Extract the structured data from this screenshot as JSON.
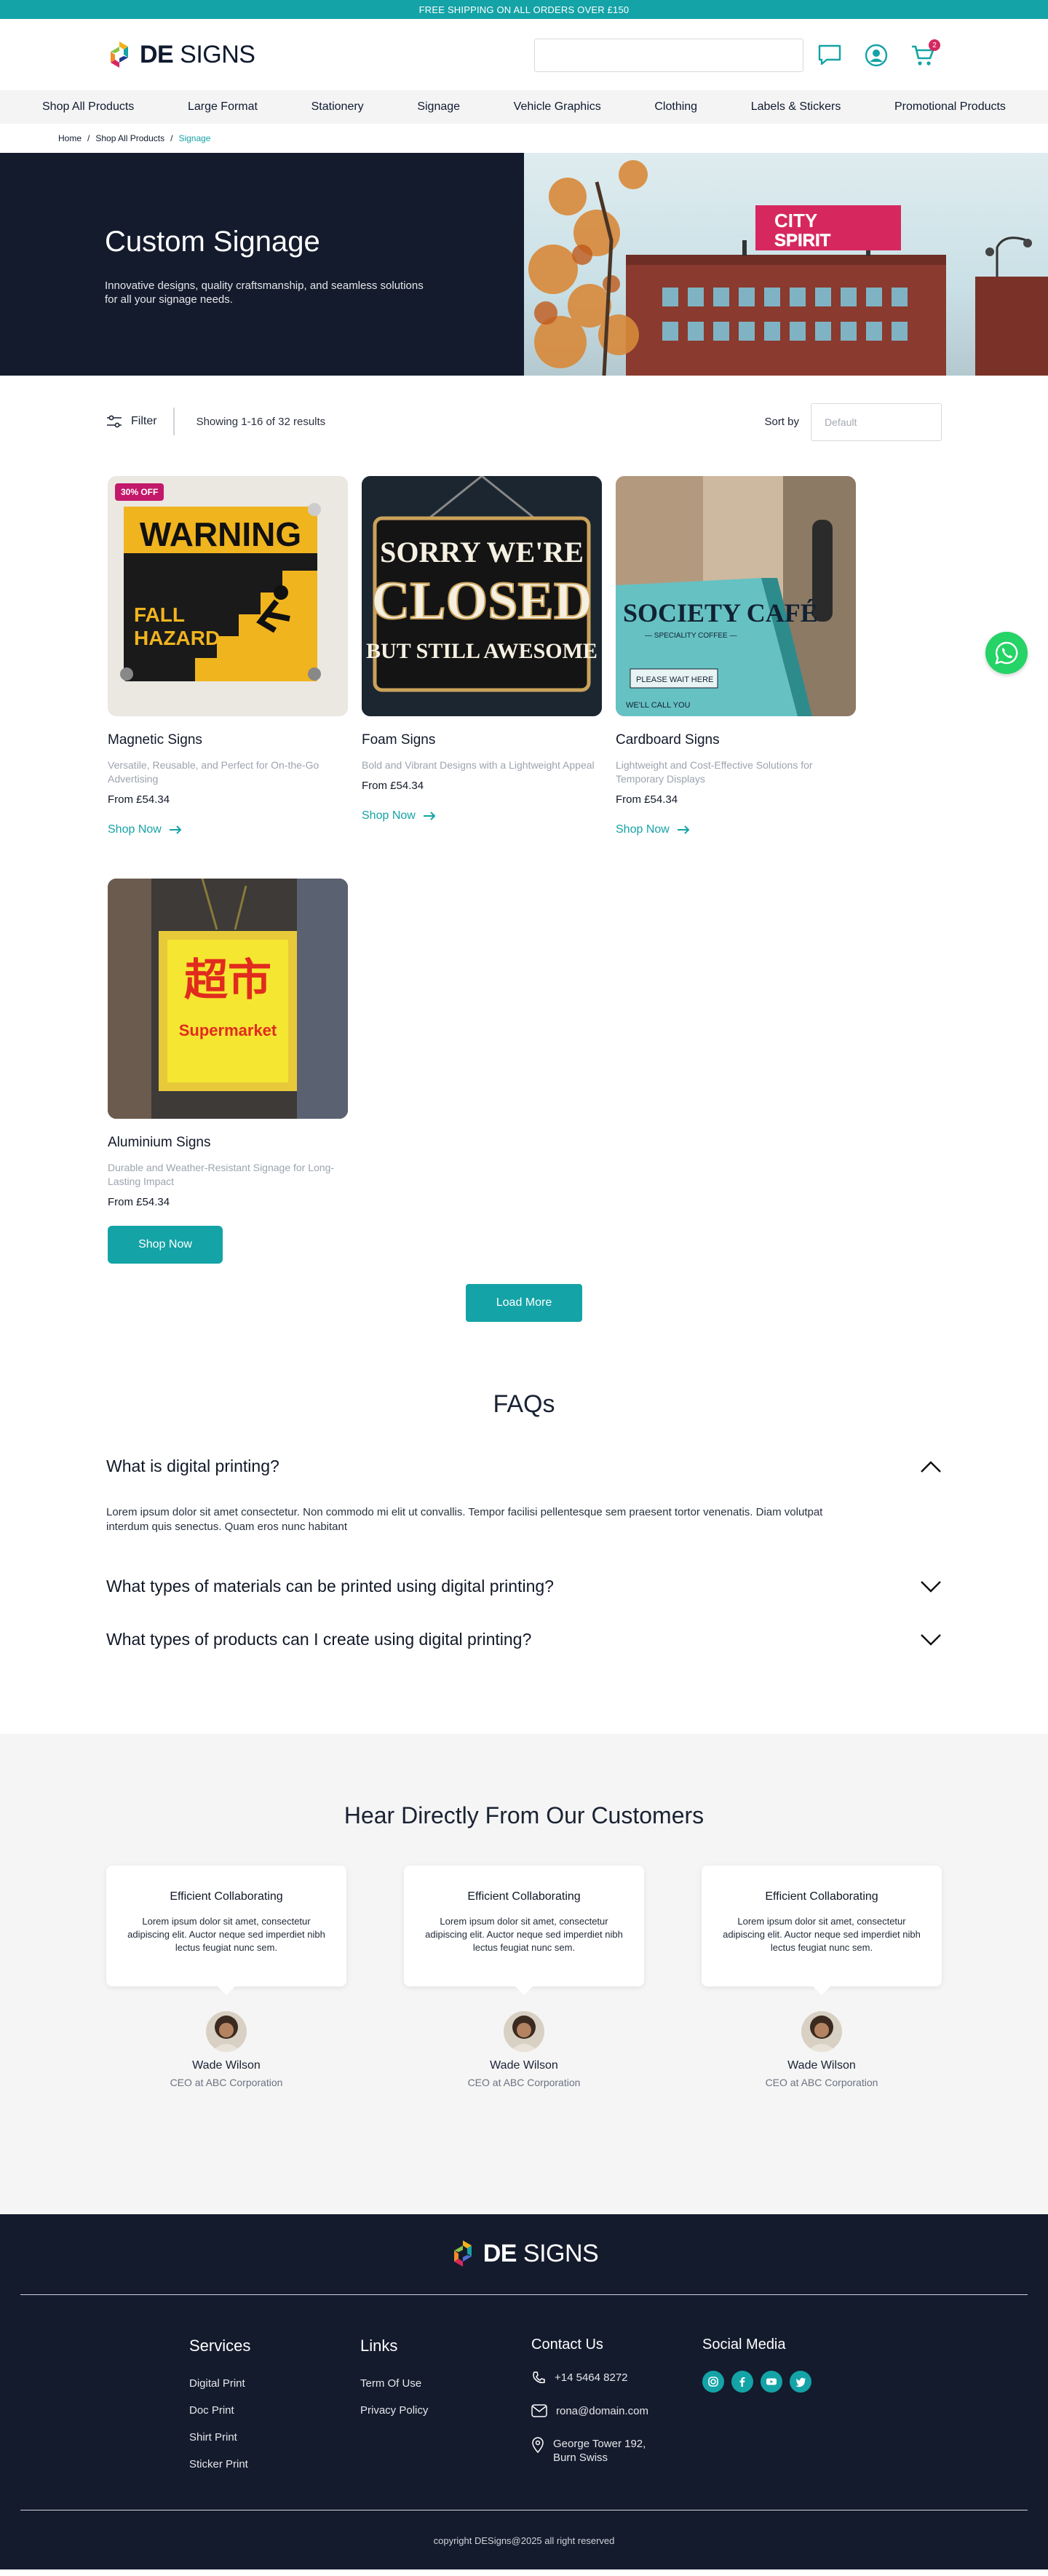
{
  "topbar": {
    "text": "FREE SHIPPING ON ALL ORDERS OVER £150"
  },
  "brand": {
    "strong": "DE",
    "rest": " SIGNS",
    "colors": {
      "accent": "#14a3a6",
      "dark": "#141b2d",
      "badge": "#c3196a"
    }
  },
  "header": {
    "search_placeholder": "",
    "cart_count": "2",
    "icons": [
      "chat-icon",
      "user-icon",
      "cart-icon"
    ]
  },
  "nav": {
    "items": [
      "Shop All Products",
      "Large Format",
      "Stationery",
      "Signage",
      "Vehicle Graphics",
      "Clothing",
      "Labels & Stickers",
      "Promotional Products"
    ]
  },
  "breadcrumb": {
    "items": [
      "Home",
      "Shop All Products",
      "Signage"
    ],
    "separator": "/"
  },
  "hero": {
    "title": "Custom Signage",
    "subtitle": "Innovative designs, quality craftsmanship, and seamless solutions for all your signage needs.",
    "billboard": {
      "line1": "CITY",
      "line2": "SPIRIT"
    }
  },
  "toolbar": {
    "filter_label": "Filter",
    "showing": "Showing 1-16 of 32 results",
    "sort_label": "Sort by",
    "sort_value": "Default"
  },
  "products": [
    {
      "title": "Magnetic Signs",
      "desc": "Versatile, Reusable, and Perfect for On-the-Go Advertising",
      "price": "From £54.34",
      "cta": "Shop Now",
      "badge": "30% OFF",
      "image_text": {
        "top": "WARNING",
        "line1": "FALL",
        "line2": "HAZARD"
      }
    },
    {
      "title": "Foam Signs",
      "desc": "Bold and Vibrant Designs with a Lightweight Appeal",
      "price": "From £54.34",
      "cta": "Shop Now",
      "image_text": {
        "l1": "SORRY WE'RE",
        "l2": "CLOSED",
        "l3": "BUT STILL AWESOME"
      }
    },
    {
      "title": "Cardboard Signs",
      "desc": "Lightweight and Cost-Effective Solutions for Temporary Displays",
      "price": "From £54.34",
      "cta": "Shop Now",
      "image_text": {
        "l1": "SOCIETY CAFÉ",
        "l2": "— SPECIALITY COFFEE —",
        "l3": "PLEASE WAIT HERE",
        "l4": "WE'LL CALL YOU"
      }
    },
    {
      "title": "Aluminium Signs",
      "desc": "Durable and Weather-Resistant Signage for Long-Lasting Impact",
      "price": "From £54.34",
      "cta": "Shop Now",
      "image_text": {
        "l1": "超市",
        "l2": "Supermarket"
      }
    }
  ],
  "load_more": "Load More",
  "faq": {
    "title": "FAQs",
    "items": [
      {
        "q": "What is digital printing?",
        "a": "Lorem ipsum dolor sit amet consectetur. Non commodo mi elit ut convallis. Tempor facilisi pellentesque sem praesent tortor venenatis. Diam volutpat interdum quis senectus. Quam eros nunc habitant",
        "open": true
      },
      {
        "q": "What types of materials can be printed using digital printing?",
        "a": "",
        "open": false
      },
      {
        "q": "What types of products can I create using digital printing?",
        "a": "",
        "open": false
      }
    ]
  },
  "testimonials": {
    "title": "Hear Directly From Our Customers",
    "items": [
      {
        "heading": "Efficient Collaborating",
        "text": "Lorem ipsum dolor sit amet, consectetur adipiscing elit. Auctor neque sed imperdiet nibh lectus feugiat nunc sem.",
        "name": "Wade Wilson",
        "role": "CEO at ABC Corporation"
      },
      {
        "heading": "Efficient Collaborating",
        "text": "Lorem ipsum dolor sit amet, consectetur adipiscing elit. Auctor neque sed imperdiet nibh lectus feugiat nunc sem.",
        "name": "Wade Wilson",
        "role": "CEO at ABC Corporation"
      },
      {
        "heading": "Efficient Collaborating",
        "text": "Lorem ipsum dolor sit amet, consectetur adipiscing elit. Auctor neque sed imperdiet nibh lectus feugiat nunc sem.",
        "name": "Wade Wilson",
        "role": "CEO at ABC Corporation"
      }
    ]
  },
  "footer": {
    "services_title": "Services",
    "services": [
      "Digital Print",
      "Doc Print",
      "Shirt Print",
      "Sticker Print"
    ],
    "links_title": "Links",
    "links": [
      "Term Of Use",
      "Privacy Policy"
    ],
    "contact_title": "Contact Us",
    "phone": "+14 5464 8272",
    "email": "rona@domain.com",
    "address": "George Tower 192, Burn Swiss",
    "social_title": "Social Media",
    "social_icons": [
      "instagram-icon",
      "facebook-icon",
      "youtube-icon",
      "twitter-icon"
    ],
    "copyright": "copyright DESigns@2025 all right reserved"
  }
}
